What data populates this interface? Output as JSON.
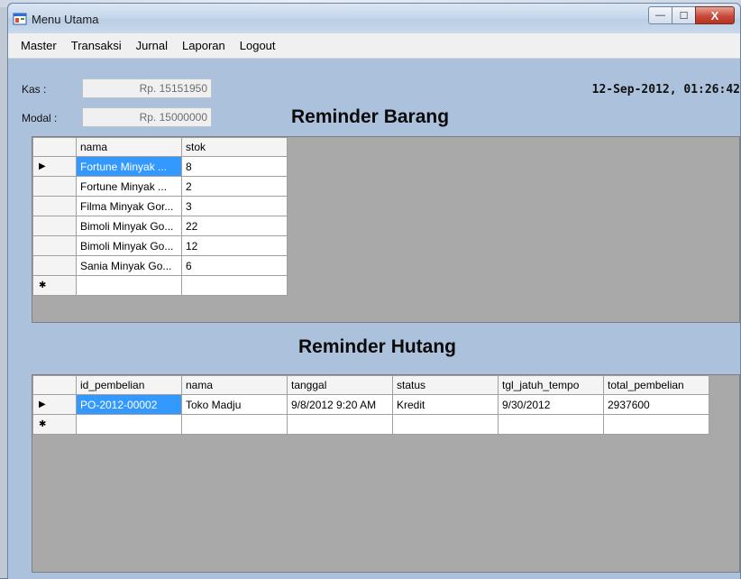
{
  "window": {
    "title": "Menu Utama"
  },
  "menu": [
    "Master",
    "Transaksi",
    "Jurnal",
    "Laporan",
    "Logout"
  ],
  "summary": {
    "kas_label": "Kas :",
    "kas_value": "Rp. 15151950",
    "modal_label": "Modal :",
    "modal_value": "Rp. 15000000",
    "datetime": "12-Sep-2012, 01:26:42"
  },
  "reminder_barang": {
    "title": "Reminder Barang",
    "columns": [
      "nama",
      "stok"
    ],
    "rows": [
      [
        "Fortune Minyak ...",
        "8"
      ],
      [
        "Fortune Minyak ...",
        "2"
      ],
      [
        "Filma Minyak Gor...",
        "3"
      ],
      [
        "Bimoli Minyak Go...",
        "22"
      ],
      [
        "Bimoli Minyak Go...",
        "12"
      ],
      [
        "Sania Minyak Go...",
        "6"
      ]
    ]
  },
  "reminder_hutang": {
    "title": "Reminder Hutang",
    "columns": [
      "id_pembelian",
      "nama",
      "tanggal",
      "status",
      "tgl_jatuh_tempo",
      "total_pembelian"
    ],
    "rows": [
      [
        "PO-2012-00002",
        "Toko Madju",
        "9/8/2012 9:20 AM",
        "Kredit",
        "9/30/2012",
        "2937600"
      ]
    ]
  },
  "glyphs": {
    "current_row": "▶",
    "new_row": "✱",
    "minimize": "—",
    "maximize": "☐",
    "close": "X"
  }
}
